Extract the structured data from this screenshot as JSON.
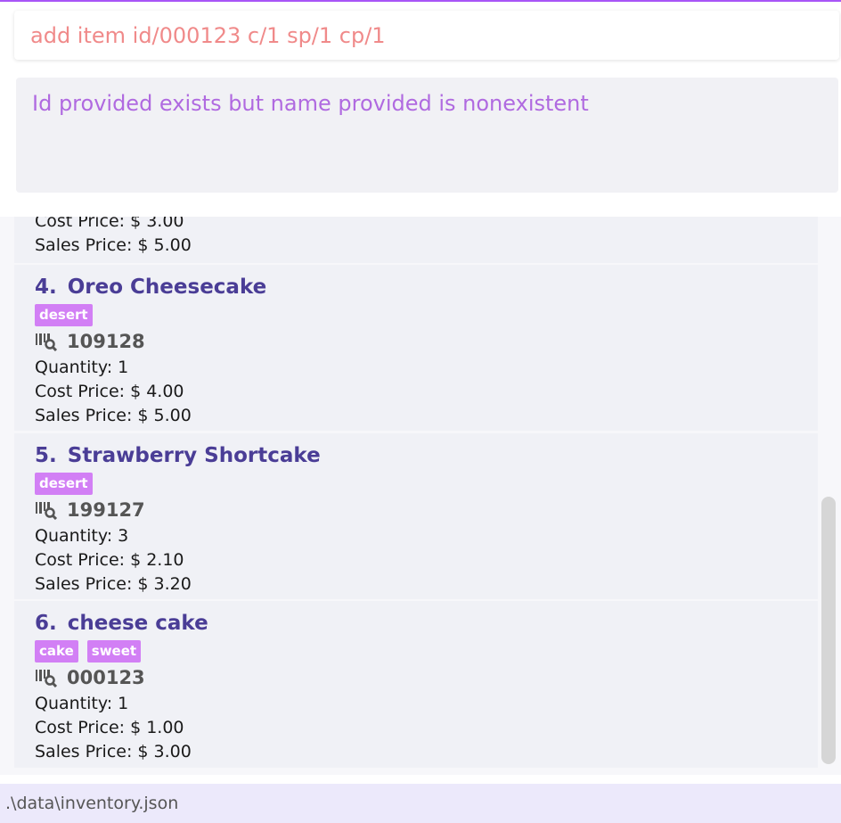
{
  "command": {
    "value": "add item id/000123 c/1 sp/1 cp/1",
    "placeholder": ""
  },
  "result": {
    "message": "Id provided exists but name provided is nonexistent"
  },
  "items": {
    "partial": {
      "cost": "Cost Price: $ 3.00",
      "sales": "Sales Price: $ 5.00"
    },
    "item4": {
      "index": "4.",
      "name": "Oreo Cheesecake",
      "tags": [
        "desert"
      ],
      "barcode": "109128",
      "quantity": "Quantity: 1",
      "cost": "Cost Price: $ 4.00",
      "sales": "Sales Price: $ 5.00"
    },
    "item5": {
      "index": "5.",
      "name": "Strawberry Shortcake",
      "tags": [
        "desert"
      ],
      "barcode": "199127",
      "quantity": "Quantity: 3",
      "cost": "Cost Price: $ 2.10",
      "sales": "Sales Price: $ 3.20"
    },
    "item6": {
      "index": "6.",
      "name": "cheese cake",
      "tags": [
        "cake",
        "sweet"
      ],
      "barcode": "000123",
      "quantity": "Quantity: 1",
      "cost": "Cost Price: $ 1.00",
      "sales": "Sales Price: $ 3.00"
    }
  },
  "status": {
    "file_path": ".\\data\\inventory.json"
  },
  "colors": {
    "accent": "#a855f7",
    "tag": "#d27ff5",
    "item_title": "#4a3d96",
    "command_text": "#f08a8a",
    "result_text": "#b06ae0"
  },
  "icons": {
    "barcode": "barcode-search-icon"
  }
}
